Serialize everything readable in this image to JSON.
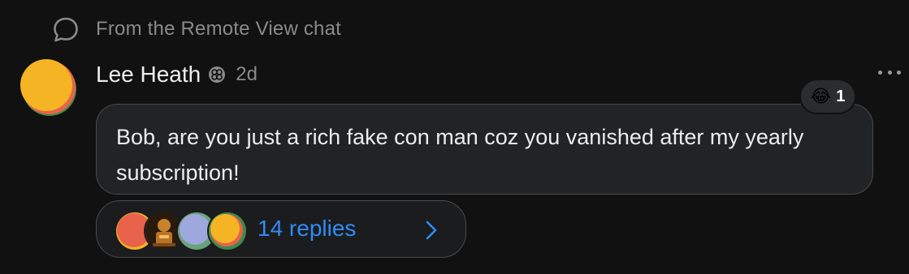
{
  "context": {
    "icon": "chat-bubble-icon",
    "text": "From the Remote View chat"
  },
  "message": {
    "author": "Lee Heath",
    "badge_icon": "verified-badge-icon",
    "time": "2d",
    "text": "Bob, are you just a rich fake con man coz you vanished after my yearly subscription!",
    "reaction": {
      "emoji": "😂",
      "count": "1"
    },
    "more_icon": "more-options-icon"
  },
  "thread": {
    "replies_label": "14 replies",
    "avatar_count": 4,
    "chevron_icon": "chevron-right-icon"
  },
  "colors": {
    "background": "#111111",
    "bubble": "#212325",
    "link": "#2f8cf4",
    "muted_text": "#8a8a8a"
  }
}
